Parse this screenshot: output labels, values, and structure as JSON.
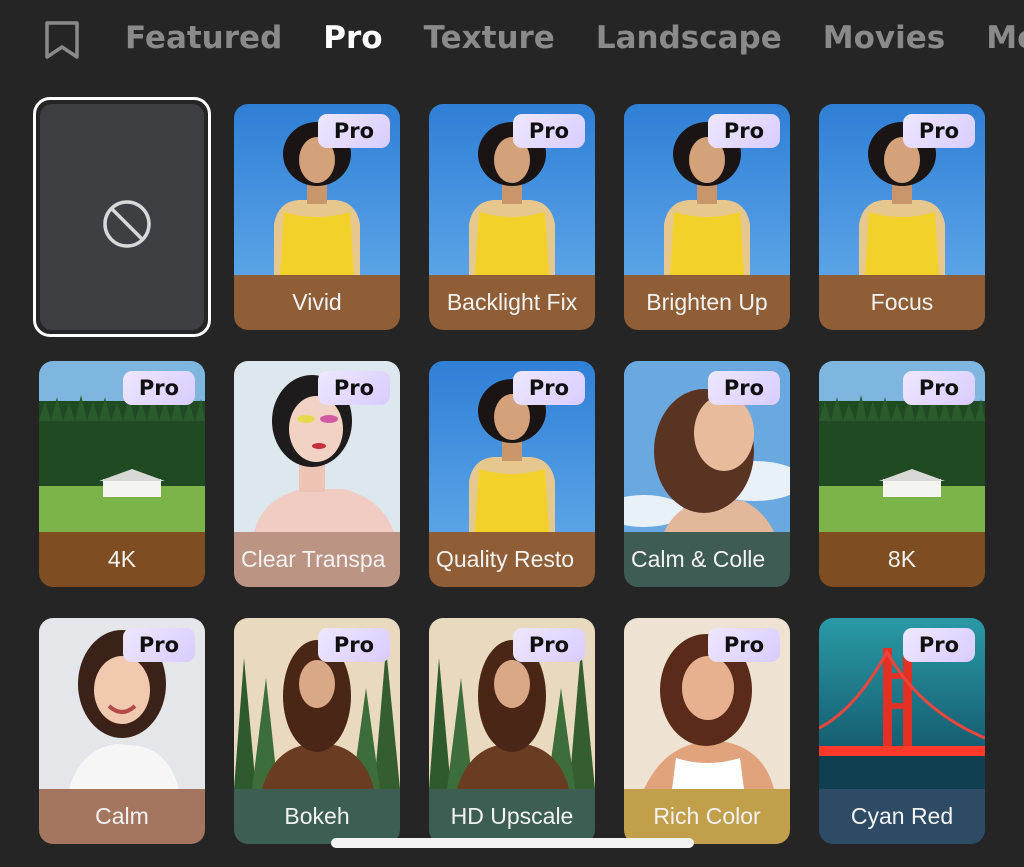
{
  "tabs": [
    {
      "label": "Featured",
      "active": false
    },
    {
      "label": "Pro",
      "active": true
    },
    {
      "label": "Texture",
      "active": false
    },
    {
      "label": "Landscape",
      "active": false
    },
    {
      "label": "Movies",
      "active": false
    },
    {
      "label": "Mono",
      "active": false
    }
  ],
  "none_option": {
    "icon": "prohibit-icon",
    "selected": true
  },
  "pro_badge": "Pro",
  "filters": [
    {
      "label": "Vivid",
      "label_color": "#8f5e37",
      "image": "woman-yellow-top"
    },
    {
      "label": "Backlight Fix",
      "label_color": "#8f5e37",
      "image": "woman-yellow-top"
    },
    {
      "label": "Brighten Up",
      "label_color": "#8f5e37",
      "image": "woman-yellow-top"
    },
    {
      "label": "Focus",
      "label_color": "#8f5e37",
      "image": "woman-yellow-top"
    },
    {
      "label": "4K",
      "label_color": "#7e4e22",
      "image": "forest-house"
    },
    {
      "label": "Clear Transpa",
      "label_color": "#bb9484",
      "image": "woman-pastel"
    },
    {
      "label": "Quality Resto",
      "label_color": "#8f5e37",
      "image": "woman-yellow-top"
    },
    {
      "label": "Calm & Colle",
      "label_color": "#3f5c54",
      "image": "woman-sky"
    },
    {
      "label": "8K",
      "label_color": "#7e4e22",
      "image": "forest-house"
    },
    {
      "label": "Calm",
      "label_color": "#a47660",
      "image": "woman-smiling"
    },
    {
      "label": "Bokeh",
      "label_color": "#3d5e52",
      "image": "woman-plants"
    },
    {
      "label": "HD Upscale",
      "label_color": "#3d5e52",
      "image": "woman-plants"
    },
    {
      "label": "Rich Color",
      "label_color": "#c2a04b",
      "image": "woman-tan"
    },
    {
      "label": "Cyan Red",
      "label_color": "#2e4b66",
      "image": "red-bridge"
    }
  ]
}
